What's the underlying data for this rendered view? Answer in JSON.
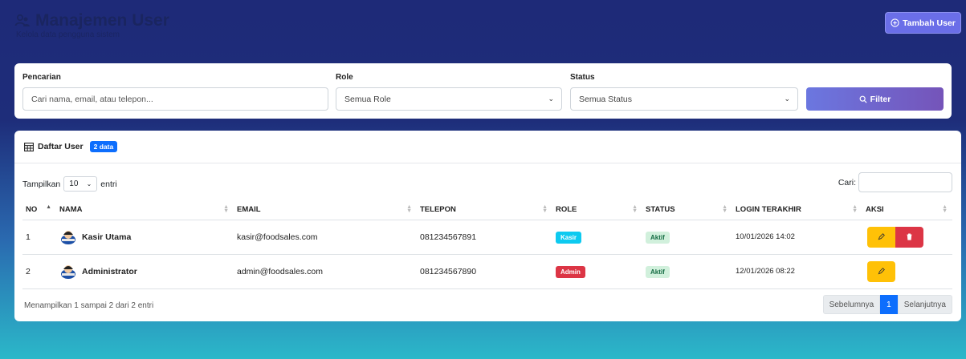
{
  "header": {
    "title": "Manajemen User",
    "subtitle": "Kelola data pengguna sistem",
    "add_button": "Tambah User"
  },
  "filters": {
    "search_label": "Pencarian",
    "search_placeholder": "Cari nama, email, atau telepon...",
    "role_label": "Role",
    "role_value": "Semua Role",
    "status_label": "Status",
    "status_value": "Semua Status",
    "filter_button": "Filter"
  },
  "list": {
    "title": "Daftar User",
    "count_badge": "2 data",
    "show_label": "Tampilkan",
    "show_value": "10",
    "entries_label": "entri",
    "search_label": "Cari:",
    "columns": [
      "NO",
      "NAMA",
      "EMAIL",
      "TELEPON",
      "ROLE",
      "STATUS",
      "LOGIN TERAKHIR",
      "AKSI"
    ],
    "rows": [
      {
        "no": "1",
        "nama": "Kasir Utama",
        "email": "kasir@foodsales.com",
        "telepon": "081234567891",
        "role": "Kasir",
        "status": "Aktif",
        "login": "10/01/2026 14:02"
      },
      {
        "no": "2",
        "nama": "Administrator",
        "email": "admin@foodsales.com",
        "telepon": "081234567890",
        "role": "Admin",
        "status": "Aktif",
        "login": "12/01/2026 08:22"
      }
    ],
    "info": "Menampilkan 1 sampai 2 dari 2 entri",
    "prev": "Sebelumnya",
    "page": "1",
    "next": "Selanjutnya"
  },
  "colors": {
    "role_kasir": "#0dcaf0",
    "role_admin": "#dc3545",
    "edit": "#ffc107",
    "delete": "#dc3545"
  },
  "icons": {
    "title": "users-icon",
    "add": "plus-circle-icon",
    "filter": "search-icon",
    "list": "table-icon",
    "edit": "pencil-icon",
    "delete": "trash-icon"
  }
}
